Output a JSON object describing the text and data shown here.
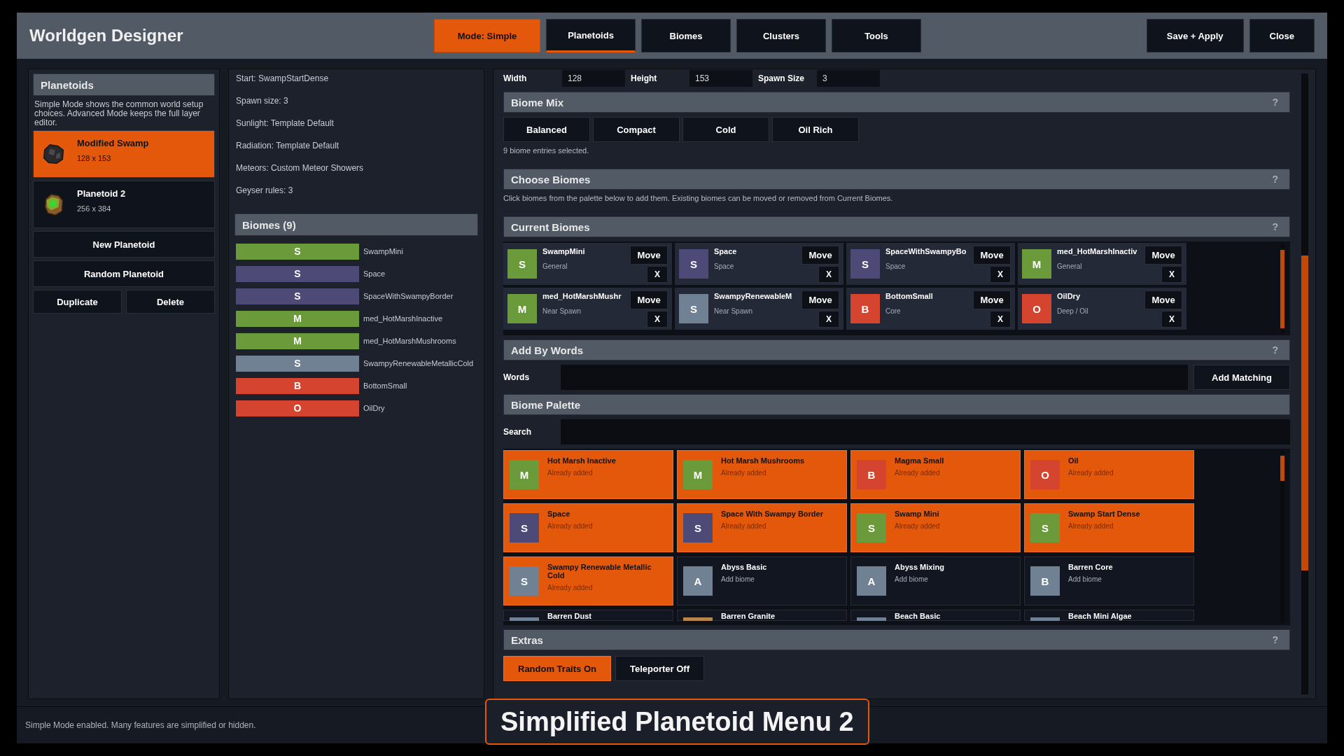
{
  "window": {
    "title": "Worldgen Designer"
  },
  "mode_button": {
    "label": "Mode: Simple",
    "on": true
  },
  "tabs": [
    {
      "label": "Planetoids",
      "selected": true
    },
    {
      "label": "Biomes",
      "selected": false
    },
    {
      "label": "Clusters",
      "selected": false
    },
    {
      "label": "Tools",
      "selected": false
    }
  ],
  "header_actions": [
    "Save + Apply",
    "Close"
  ],
  "planetoids": {
    "title": "Planetoids",
    "description": "Simple Mode shows the common world setup choices. Advanced Mode keeps the full layer editor.",
    "items": [
      {
        "name": "Modified Swamp",
        "size": "128 x 153",
        "kind": "dark-rock",
        "selected": true
      },
      {
        "name": "Planetoid 2",
        "size": "256 x 384",
        "kind": "mossy-rock",
        "selected": false
      }
    ],
    "actions": [
      "New Planetoid",
      "Random Planetoid"
    ],
    "pair_actions": [
      "Duplicate",
      "Delete"
    ]
  },
  "summary": [
    "Start: SwampStartDense",
    "Spawn size: 3",
    "Sunlight: Template Default",
    "Radiation: Template Default",
    "Meteors: Custom Meteor Showers",
    "Geyser rules: 3"
  ],
  "biome_list": {
    "title": "Biomes (9)",
    "items": [
      {
        "letter": "S",
        "name": "SwampMini",
        "color": "#6a9a3a"
      },
      {
        "letter": "S",
        "name": "Space",
        "color": "#4e4a78"
      },
      {
        "letter": "S",
        "name": "SpaceWithSwampyBorder",
        "color": "#4e4a78"
      },
      {
        "letter": "M",
        "name": "med_HotMarshInactive",
        "color": "#6a9a3a"
      },
      {
        "letter": "M",
        "name": "med_HotMarshMushrooms",
        "color": "#6a9a3a"
      },
      {
        "letter": "S",
        "name": "SwampyRenewableMetallicCold",
        "color": "#6f8192"
      },
      {
        "letter": "B",
        "name": "BottomSmall",
        "color": "#d4442e"
      },
      {
        "letter": "O",
        "name": "OilDry",
        "color": "#d4442e"
      }
    ]
  },
  "size_fields": [
    {
      "label": "Width",
      "value": "128"
    },
    {
      "label": "Height",
      "value": "153"
    },
    {
      "label": "Spawn Size",
      "value": "3"
    }
  ],
  "biome_mix": {
    "title": "Biome Mix",
    "help": "?",
    "presets": [
      "Balanced",
      "Compact",
      "Cold",
      "Oil Rich"
    ],
    "note": "9 biome entries selected."
  },
  "choose_biomes": {
    "title": "Choose Biomes",
    "help": "?",
    "note": "Click biomes from the palette below to add them. Existing biomes can be moved or removed from Current Biomes."
  },
  "current_biomes": {
    "title": "Current Biomes",
    "help": "?",
    "items": [
      {
        "letter": "S",
        "name": "SwampMini",
        "zone": "General",
        "color": "#6a9a3a",
        "move": "Move",
        "remove": "X"
      },
      {
        "letter": "S",
        "name": "Space",
        "zone": "Space",
        "color": "#4e4a78",
        "move": "Move",
        "remove": "X"
      },
      {
        "letter": "S",
        "name": "SpaceWithSwampyBo",
        "zone": "Space",
        "color": "#4e4a78",
        "move": "Move",
        "remove": "X"
      },
      {
        "letter": "M",
        "name": "med_HotMarshInactiv",
        "zone": "General",
        "color": "#6a9a3a",
        "move": "Move",
        "remove": "X"
      },
      {
        "letter": "M",
        "name": "med_HotMarshMushr",
        "zone": "Near Spawn",
        "color": "#6a9a3a",
        "move": "Move",
        "remove": "X"
      },
      {
        "letter": "S",
        "name": "SwampyRenewableM",
        "zone": "Near Spawn",
        "color": "#6f8192",
        "move": "Move",
        "remove": "X"
      },
      {
        "letter": "B",
        "name": "BottomSmall",
        "zone": "Core",
        "color": "#d4442e",
        "move": "Move",
        "remove": "X"
      },
      {
        "letter": "O",
        "name": "OilDry",
        "zone": "Deep / Oil",
        "color": "#d4442e",
        "move": "Move",
        "remove": "X"
      }
    ]
  },
  "add_by_words": {
    "title": "Add By Words",
    "help": "?",
    "label": "Words",
    "button": "Add Matching"
  },
  "biome_palette": {
    "title": "Biome Palette",
    "search_label": "Search",
    "items": [
      {
        "letter": "M",
        "name": "Hot Marsh Inactive",
        "note": "Already added",
        "color": "#6a9a3a",
        "added": true
      },
      {
        "letter": "M",
        "name": "Hot Marsh Mushrooms",
        "note": "Already added",
        "color": "#6a9a3a",
        "added": true
      },
      {
        "letter": "B",
        "name": "Magma Small",
        "note": "Already added",
        "color": "#d4442e",
        "added": true
      },
      {
        "letter": "O",
        "name": "Oil",
        "note": "Already added",
        "color": "#d4442e",
        "added": true
      },
      {
        "letter": "S",
        "name": "Space",
        "note": "Already added",
        "color": "#4e4a78",
        "added": true
      },
      {
        "letter": "S",
        "name": "Space With Swampy Border",
        "note": "Already added",
        "color": "#4e4a78",
        "added": true
      },
      {
        "letter": "S",
        "name": "Swamp Mini",
        "note": "Already added",
        "color": "#6a9a3a",
        "added": true
      },
      {
        "letter": "S",
        "name": "Swamp Start Dense",
        "note": "Already added",
        "color": "#6a9a3a",
        "added": true
      },
      {
        "letter": "S",
        "name": "Swampy Renewable Metallic Cold",
        "note": "Already added",
        "color": "#6f8192",
        "added": true
      },
      {
        "letter": "A",
        "name": "Abyss Basic",
        "note": "Add biome",
        "color": "#6f8192",
        "added": false
      },
      {
        "letter": "A",
        "name": "Abyss Mixing",
        "note": "Add biome",
        "color": "#6f8192",
        "added": false
      },
      {
        "letter": "B",
        "name": "Barren Core",
        "note": "Add biome",
        "color": "#6f8192",
        "added": false
      },
      {
        "name": "Barren Dust",
        "color": "#6f8192",
        "added": false
      },
      {
        "name": "Barren Granite",
        "color": "#b8864a",
        "added": false
      },
      {
        "name": "Beach Basic",
        "color": "#6f8192",
        "added": false
      },
      {
        "name": "Beach Mini Algae",
        "color": "#6f8192",
        "added": false
      }
    ]
  },
  "extras": {
    "title": "Extras",
    "help": "?",
    "toggles": [
      {
        "label": "Random Traits On",
        "on": true
      },
      {
        "label": "Teleporter Off",
        "on": false
      }
    ]
  },
  "status_bar": "Simple Mode enabled. Many features are simplified or hidden.",
  "caption": "Simplified Planetoid Menu 2"
}
